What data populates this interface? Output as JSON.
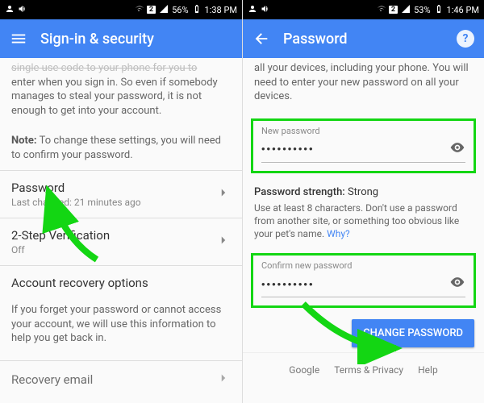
{
  "left": {
    "status": {
      "battery": "56%",
      "time": "1:38 PM",
      "sim": "2"
    },
    "appbar": {
      "title": "Sign-in & security"
    },
    "intro_top": "single use code to your phone for you to",
    "intro": "enter when you sign in. So even if somebody manages to steal your password, it is not enough to get into your account.",
    "note_label": "Note:",
    "note_text": " To change these settings, you will need to confirm your password.",
    "password": {
      "title": "Password",
      "sub": "Last changed: 21 minutes ago"
    },
    "twostep": {
      "title": "2-Step Verification",
      "sub": "Off"
    },
    "recovery_title": "Account recovery options",
    "recovery_desc": "If you forget your password or cannot access your account, we will use this information to help you get back in.",
    "recovery_email_title": "Recovery email"
  },
  "right": {
    "status": {
      "battery": "53%",
      "time": "1:46 PM",
      "sim": "2"
    },
    "appbar": {
      "title": "Password",
      "help": "?"
    },
    "intro": "all your devices, including your phone. You will need to enter your new password on all your devices.",
    "new_pw": {
      "label": "New password",
      "value": "••••••••••"
    },
    "strength_label": "Password strength:",
    "strength_value": " Strong",
    "hint": "Use at least 8 characters. Don't use a password from another site, or something too obvious like your pet's name. ",
    "hint_link": "Why?",
    "confirm_pw": {
      "label": "Confirm new password",
      "value": "••••••••••"
    },
    "button": "CHANGE PASSWORD",
    "footer": {
      "a": "Google",
      "b": "Terms & Privacy",
      "c": "Help"
    }
  }
}
